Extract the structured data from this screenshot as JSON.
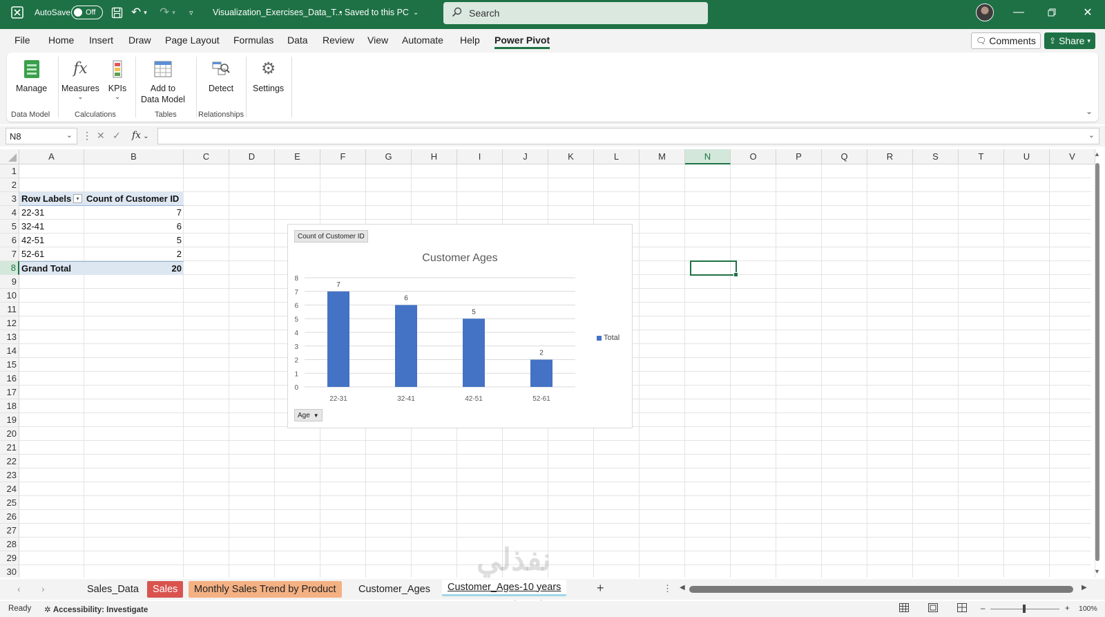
{
  "titlebar": {
    "autosave_label": "AutoSave",
    "autosave_state": "Off",
    "filename": "Visualization_Exercises_Data_T...",
    "save_status": "• Saved to this PC",
    "search_placeholder": "Search"
  },
  "menu": {
    "tabs": [
      "File",
      "Home",
      "Insert",
      "Draw",
      "Page Layout",
      "Formulas",
      "Data",
      "Review",
      "View",
      "Automate",
      "Help",
      "Power Pivot"
    ],
    "active_tab": "Power Pivot",
    "comments_label": "Comments",
    "share_label": "Share"
  },
  "ribbon": {
    "manage": "Manage",
    "measures": "Measures",
    "kpis": "KPIs",
    "add_to": "Add to",
    "data_model": "Data Model",
    "detect": "Detect",
    "settings": "Settings",
    "groups": {
      "data_model": "Data Model",
      "calculations": "Calculations",
      "tables": "Tables",
      "relationships": "Relationships"
    }
  },
  "formula_bar": {
    "name_box": "N8",
    "fx_label": "fx",
    "value": ""
  },
  "grid": {
    "columns": [
      "A",
      "B",
      "C",
      "D",
      "E",
      "F",
      "G",
      "H",
      "I",
      "J",
      "K",
      "L",
      "M",
      "N",
      "O",
      "P",
      "Q",
      "R",
      "S",
      "T",
      "U",
      "V"
    ],
    "rows": [
      "1",
      "2",
      "3",
      "4",
      "5",
      "6",
      "7",
      "8",
      "9",
      "10",
      "11",
      "12",
      "13",
      "14",
      "15",
      "16",
      "17",
      "18",
      "19",
      "20",
      "21",
      "22",
      "23",
      "24",
      "25",
      "26",
      "27",
      "28",
      "29",
      "30"
    ],
    "selected_col": "N",
    "selected_row": "8"
  },
  "pivot": {
    "header_row_labels": "Row Labels",
    "header_count": "Count of Customer ID",
    "rows": [
      {
        "label": "22-31",
        "value": "7"
      },
      {
        "label": "32-41",
        "value": "6"
      },
      {
        "label": "42-51",
        "value": "5"
      },
      {
        "label": "52-61",
        "value": "2"
      }
    ],
    "total_label": "Grand Total",
    "total_value": "20"
  },
  "chart_field_buttons": {
    "value_field": "Count of Customer ID",
    "axis_field": "Age"
  },
  "chart_data": {
    "type": "bar",
    "title": "Customer Ages",
    "categories": [
      "22-31",
      "32-41",
      "42-51",
      "52-61"
    ],
    "series": [
      {
        "name": "Total",
        "values": [
          7,
          6,
          5,
          2
        ],
        "color": "#4472c4"
      }
    ],
    "ylim": [
      0,
      8
    ],
    "yticks": [
      0,
      1,
      2,
      3,
      4,
      5,
      6,
      7,
      8
    ],
    "data_labels": true,
    "grid": true,
    "legend": "right"
  },
  "sheets": {
    "tabs": [
      {
        "label": "Sales_Data",
        "color": ""
      },
      {
        "label": "Sales",
        "color": "#d9534f"
      },
      {
        "label": "Monthly Sales Trend by Product",
        "color": "#f4b183"
      },
      {
        "label": "Customer_Ages",
        "color": ""
      },
      {
        "label": "Customer_Ages-10 years",
        "color": "active"
      }
    ],
    "add_label": "+"
  },
  "status": {
    "ready": "Ready",
    "accessibility": "Accessibility: Investigate",
    "zoom": "100%"
  },
  "watermark": {
    "text": "نفذلي",
    "url": "nafezly.com"
  }
}
